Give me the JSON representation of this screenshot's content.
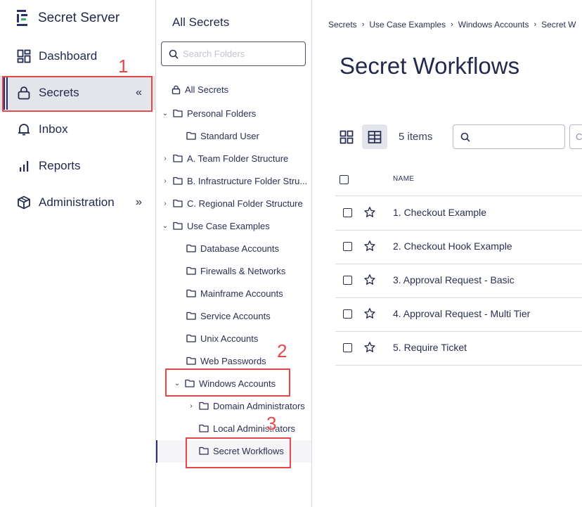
{
  "app": {
    "name": "Secret Server"
  },
  "nav": {
    "items": [
      {
        "label": "Dashboard"
      },
      {
        "label": "Secrets",
        "chevron": "«"
      },
      {
        "label": "Inbox"
      },
      {
        "label": "Reports"
      },
      {
        "label": "Administration",
        "chevron": "»"
      }
    ]
  },
  "folders": {
    "title": "All Secrets",
    "search_placeholder": "Search Folders",
    "tree": [
      {
        "label": "All Secrets"
      },
      {
        "label": "Personal Folders",
        "toggle": "⌄"
      },
      {
        "label": "Standard User"
      },
      {
        "label": "A. Team Folder Structure",
        "toggle": "›"
      },
      {
        "label": "B. Infrastructure Folder Stru...",
        "toggle": "›"
      },
      {
        "label": "C. Regional Folder Structure",
        "toggle": "›"
      },
      {
        "label": "Use Case Examples",
        "toggle": "⌄"
      },
      {
        "label": "Database Accounts"
      },
      {
        "label": "Firewalls & Networks"
      },
      {
        "label": "Mainframe Accounts"
      },
      {
        "label": "Service Accounts"
      },
      {
        "label": "Unix Accounts"
      },
      {
        "label": "Web Passwords"
      },
      {
        "label": "Windows Accounts",
        "toggle": "⌄"
      },
      {
        "label": "Domain Administrators",
        "toggle": "›"
      },
      {
        "label": "Local Administrators"
      },
      {
        "label": "Secret Workflows"
      }
    ]
  },
  "main": {
    "breadcrumb": [
      "Secrets",
      "Use Case Examples",
      "Windows Accounts",
      "Secret W"
    ],
    "breadcrumb_sep": "›",
    "title": "Secret Workflows",
    "items_count": "5 items",
    "filter_stub": "C",
    "column_name": "NAME",
    "rows": [
      {
        "name": "1. Checkout Example"
      },
      {
        "name": "2. Checkout Hook Example"
      },
      {
        "name": "3. Approval Request - Basic"
      },
      {
        "name": "4. Approval Request - Multi Tier"
      },
      {
        "name": "5. Require Ticket"
      }
    ]
  },
  "annotations": [
    "1",
    "2",
    "3"
  ],
  "colors": {
    "accent": "#2c2f6e",
    "highlight": "#e8474a",
    "text": "#232a4d"
  }
}
